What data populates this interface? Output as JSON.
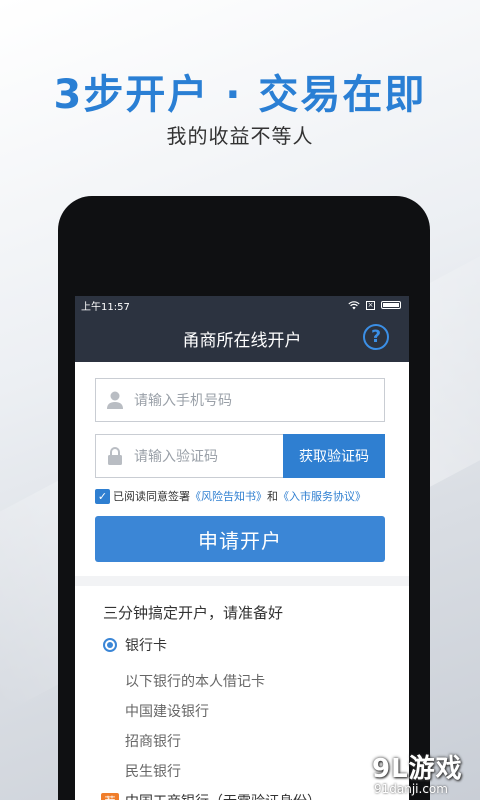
{
  "promo": {
    "headline": "3步开户 · 交易在即",
    "subline": "我的收益不等人"
  },
  "status_bar": {
    "time": "上午11:57"
  },
  "header": {
    "title": "甬商所在线开户",
    "help_glyph": "?"
  },
  "form": {
    "phone_placeholder": "请输入手机号码",
    "code_placeholder": "请输入验证码",
    "get_code_label": "获取验证码",
    "agree_prefix": "已阅读同意签署",
    "agree_link1": "《风险告知书》",
    "agree_mid": "和",
    "agree_link2": "《入市服务协议》",
    "agree_checked": true,
    "submit_label": "申请开户"
  },
  "prep": {
    "title": "三分钟搞定开户，请准备好",
    "option_label": "银行卡",
    "hint": "以下银行的本人借记卡",
    "banks": [
      "中国建设银行",
      "招商银行",
      "民生银行"
    ],
    "recommended_badge": "荐",
    "recommended_bank": "中国工商银行（无需验证身份）"
  },
  "watermark": {
    "main": "9L游戏",
    "sub": "91danji.com"
  },
  "colors": {
    "accent": "#2f7fd1",
    "headline": "#2a7fd4",
    "header_bg": "#2c3340",
    "badge": "#f07d2a"
  }
}
